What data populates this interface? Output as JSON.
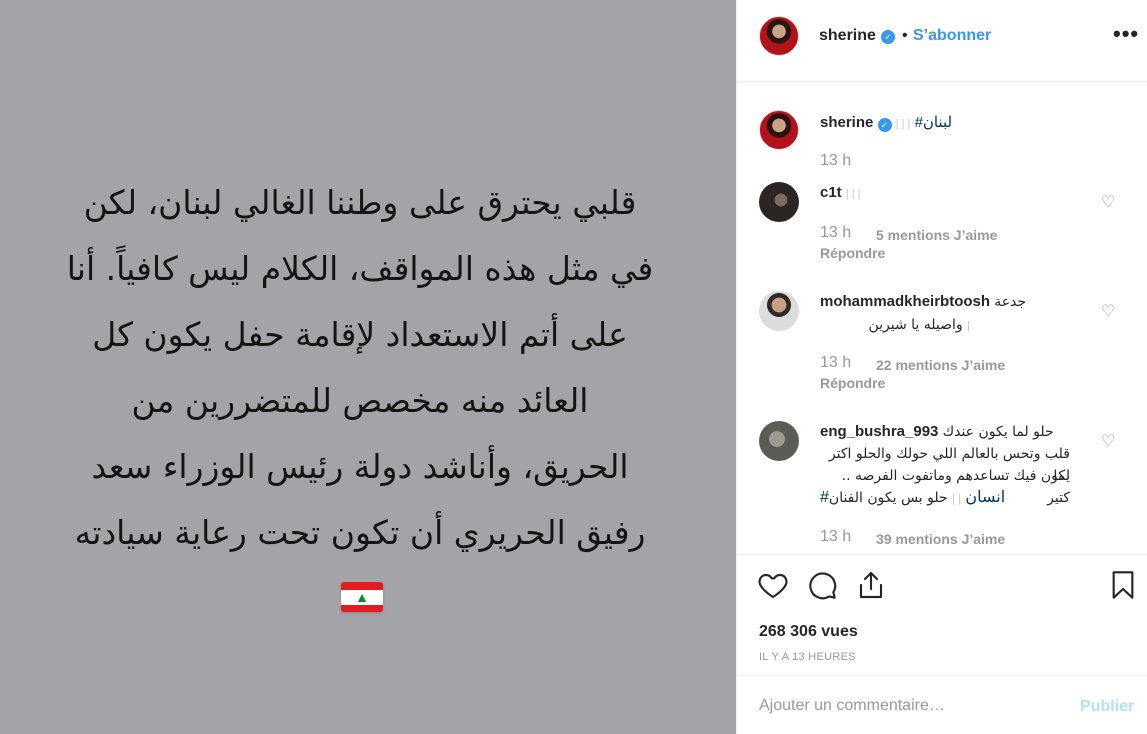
{
  "post": {
    "image_text_lines": [
      "قلبي يحترق على وطننا الغالي لبنان، لكن",
      "في مثل هذه المواقف، الكلام ليس كافياً. أنا",
      "على أتم الاستعداد لإقامة حفل يكون كل",
      "العائد منه مخصص للمتضررين من",
      "الحريق، وأناشد دولة رئيس الوزراء سعد",
      "رفيق الحريري أن تكون تحت رعاية سيادته"
    ],
    "image_flag_icon": "lebanon-flag-icon"
  },
  "header": {
    "username": "sherine",
    "dot": "•",
    "follow_label": "S’abonner",
    "more_label": "•••"
  },
  "caption": {
    "username": "sherine",
    "ghost": "| | |",
    "hashtag": "#لبنان",
    "time": "13 h"
  },
  "comments": [
    {
      "username": "c1t",
      "ghost": "| | |",
      "time": "13 h",
      "likes": "5 mentions J’aime",
      "reply": "Répondre"
    },
    {
      "username": "mohammadkheirbtoosh",
      "text_line1": "جدعة",
      "text_line2": "واصيله يا شيرين",
      "ghost": "|",
      "time": "13 h",
      "likes": "22 mentions J’aime",
      "reply": "Répondre"
    },
    {
      "username": "eng_bushra_993",
      "text_line1": "حلو لما يكون عندك",
      "text_line2": "قلب وتحس بالعالم اللي حولك والحلو اكتر لما",
      "text_line3": "يكون فيك تساعدهم وماتفوت الفرصه .. كتير",
      "text_line4": "حلو بس يكون الفنان",
      "ghost": "| |",
      "hashtag": "#انسان",
      "time": "13 h",
      "likes": "39 mentions J’aime"
    }
  ],
  "actions": {
    "views": "268 306 vues",
    "ago": "IL Y A 13 HEURES"
  },
  "add_comment": {
    "placeholder": "Ajouter un commentaire…",
    "publish_label": "Publier"
  },
  "colors": {
    "accent": "#3897f0",
    "media_bg": "#a3a3a8",
    "muted": "#999999",
    "publish_disabled": "#b2dffc"
  }
}
